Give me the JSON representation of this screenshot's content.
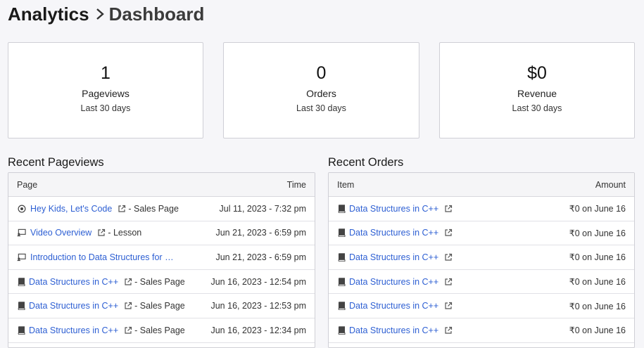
{
  "breadcrumb": {
    "root": "Analytics",
    "current": "Dashboard"
  },
  "stats": [
    {
      "value": "1",
      "label": "Pageviews",
      "period": "Last 30 days"
    },
    {
      "value": "0",
      "label": "Orders",
      "period": "Last 30 days"
    },
    {
      "value": "$0",
      "label": "Revenue",
      "period": "Last 30 days"
    }
  ],
  "pageviews": {
    "title": "Recent Pageviews",
    "col_page": "Page",
    "col_time": "Time",
    "rows": [
      {
        "icon": "radio-target-icon",
        "name": "Hey Kids, Let's Code",
        "type": "- Sales Page",
        "time": "Jul 11, 2023 - 7:32 pm"
      },
      {
        "icon": "screen-lesson-icon",
        "name": "Video Overview",
        "type": "- Lesson",
        "time": "Jun 21, 2023 - 6:59 pm"
      },
      {
        "icon": "screen-lesson-icon",
        "name": "Introduction to Data Structures for Hi...",
        "type": "",
        "time": "Jun 21, 2023 - 6:59 pm"
      },
      {
        "icon": "book-icon",
        "name": "Data Structures in C++",
        "type": "- Sales Page",
        "time": "Jun 16, 2023 - 12:54 pm"
      },
      {
        "icon": "book-icon",
        "name": "Data Structures in C++",
        "type": "- Sales Page",
        "time": "Jun 16, 2023 - 12:53 pm"
      },
      {
        "icon": "book-icon",
        "name": "Data Structures in C++",
        "type": "- Sales Page",
        "time": "Jun 16, 2023 - 12:34 pm"
      }
    ]
  },
  "orders": {
    "title": "Recent Orders",
    "col_item": "Item",
    "col_amount": "Amount",
    "rows": [
      {
        "icon": "book-icon",
        "name": "Data Structures in C++",
        "amount": "₹0 on June 16"
      },
      {
        "icon": "book-icon",
        "name": "Data Structures in C++",
        "amount": "₹0 on June 16"
      },
      {
        "icon": "book-icon",
        "name": "Data Structures in C++",
        "amount": "₹0 on June 16"
      },
      {
        "icon": "book-icon",
        "name": "Data Structures in C++",
        "amount": "₹0 on June 16"
      },
      {
        "icon": "book-icon",
        "name": "Data Structures in C++",
        "amount": "₹0 on June 16"
      },
      {
        "icon": "book-icon",
        "name": "Data Structures in C++",
        "amount": "₹0 on June 16"
      }
    ]
  },
  "colors": {
    "link": "#2d5fd3",
    "background": "#f6f6f9",
    "border": "#cfcfd6"
  }
}
